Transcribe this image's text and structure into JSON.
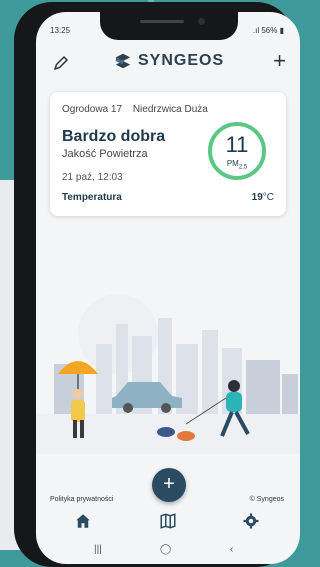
{
  "status_bar": {
    "time": "13:25",
    "battery": "56%"
  },
  "app": {
    "brand": "SYNGEOS"
  },
  "card": {
    "location_street": "Ogrodowa 17",
    "location_town": "Niedrzwica Duża",
    "quality": "Bardzo dobra",
    "quality_subtitle": "Jakość Powietrza",
    "date": "21 paź, 12:03",
    "temperature_label": "Temperatura",
    "temperature_value": "19",
    "temperature_unit": "°C",
    "pm_value": "11",
    "pm_label": "PM",
    "pm_sub": "2,5",
    "gauge_color": "#5cc785"
  },
  "footer": {
    "privacy": "Polityka prywatności",
    "copyright": "© Syngeos"
  },
  "fab": {
    "label": "+"
  },
  "nav": {
    "items": [
      "home-icon",
      "map-icon",
      "settings-icon"
    ]
  },
  "colors": {
    "brand_dark": "#2a4b62",
    "background": "#3f9a9b"
  }
}
